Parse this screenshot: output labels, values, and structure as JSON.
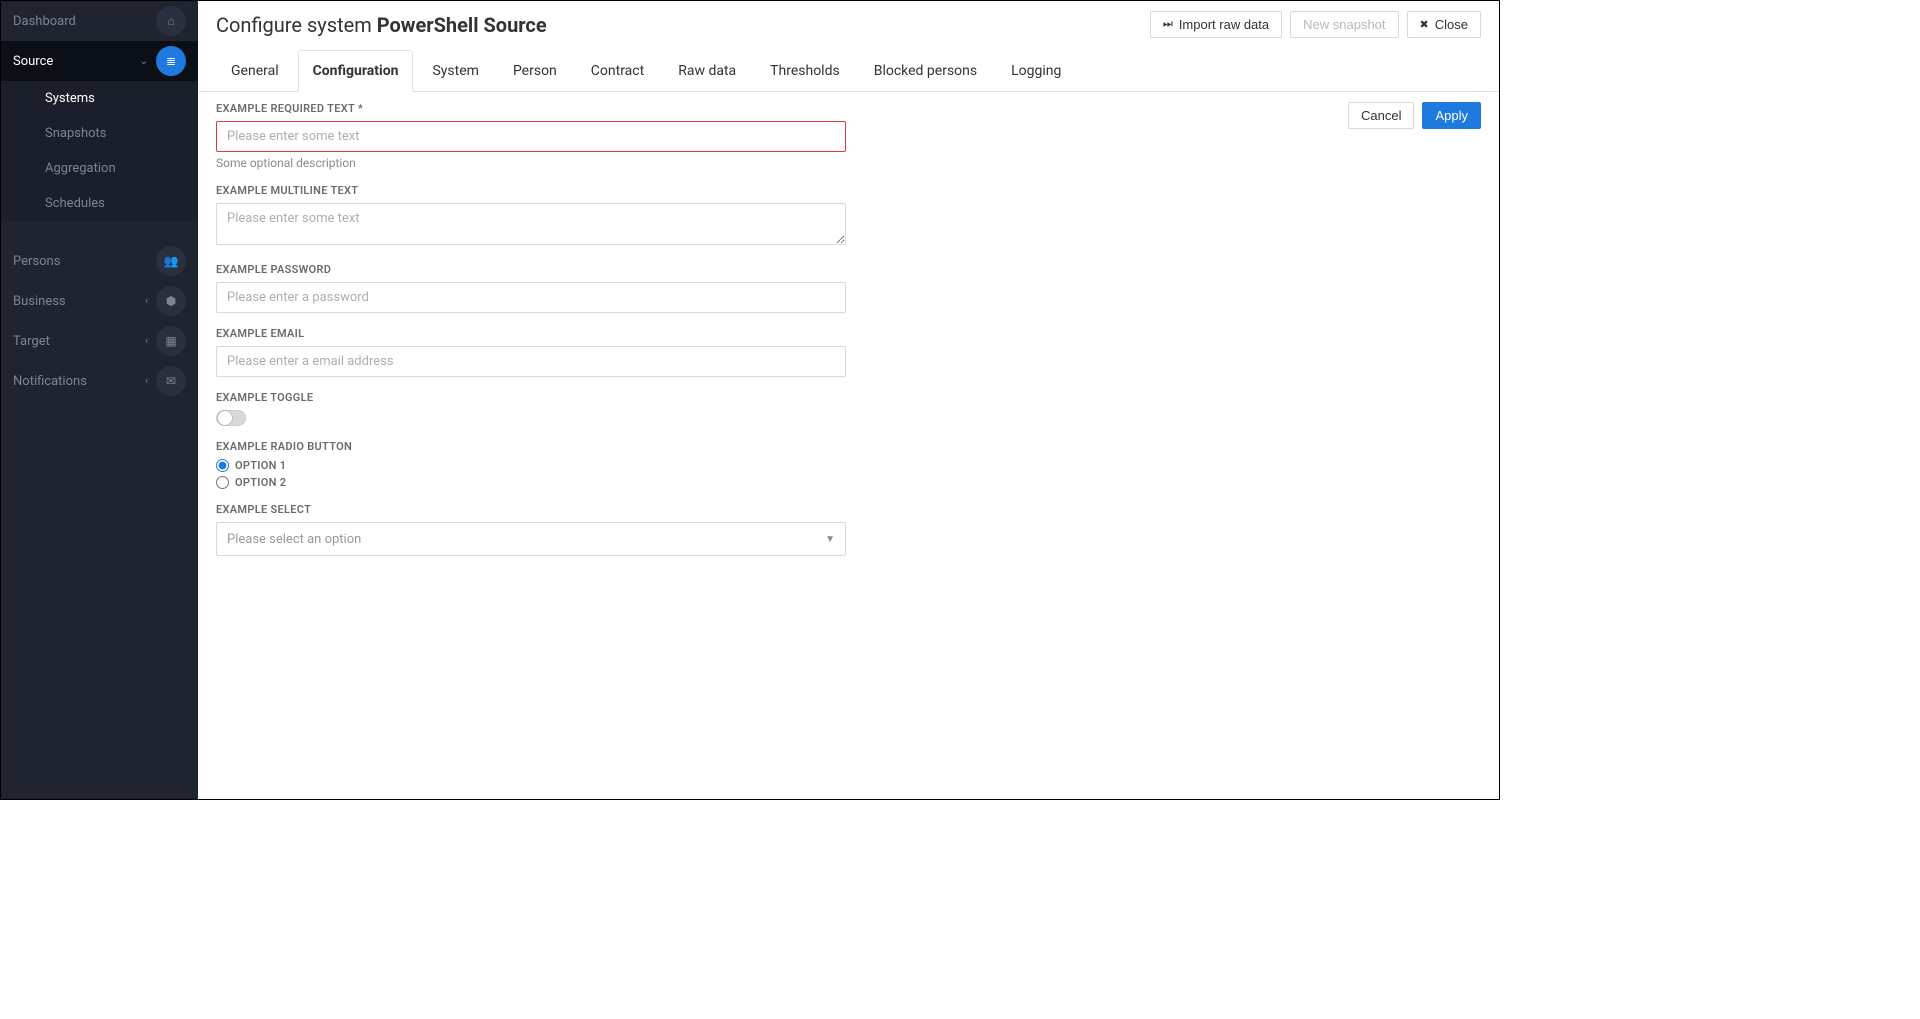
{
  "sidebar": {
    "items": [
      {
        "label": "Dashboard",
        "icon": "home-icon",
        "glyph": "⌂",
        "expandable": false,
        "active": false
      },
      {
        "label": "Source",
        "icon": "database-icon",
        "glyph": "≣",
        "expandable": true,
        "active": true,
        "icon_blue": true,
        "children": [
          {
            "label": "Systems",
            "selected": true
          },
          {
            "label": "Snapshots",
            "selected": false
          },
          {
            "label": "Aggregation",
            "selected": false
          },
          {
            "label": "Schedules",
            "selected": false
          }
        ]
      },
      {
        "label": "Persons",
        "icon": "users-icon",
        "glyph": "👥",
        "expandable": false,
        "active": false
      },
      {
        "label": "Business",
        "icon": "globe-icon",
        "glyph": "⬢",
        "expandable": true,
        "active": false
      },
      {
        "label": "Target",
        "icon": "grid-icon",
        "glyph": "▦",
        "expandable": true,
        "active": false
      },
      {
        "label": "Notifications",
        "icon": "envelope-icon",
        "glyph": "✉",
        "expandable": true,
        "active": false
      }
    ]
  },
  "header": {
    "title_prefix": "Configure system ",
    "title_bold": "PowerShell Source",
    "actions": {
      "import": "Import raw data",
      "snapshot": "New snapshot",
      "close": "Close"
    }
  },
  "tabs": [
    {
      "label": "General",
      "active": false
    },
    {
      "label": "Configuration",
      "active": true
    },
    {
      "label": "System",
      "active": false
    },
    {
      "label": "Person",
      "active": false
    },
    {
      "label": "Contract",
      "active": false
    },
    {
      "label": "Raw data",
      "active": false
    },
    {
      "label": "Thresholds",
      "active": false
    },
    {
      "label": "Blocked persons",
      "active": false
    },
    {
      "label": "Logging",
      "active": false
    }
  ],
  "form": {
    "required_text": {
      "label": "EXAMPLE REQUIRED TEXT *",
      "placeholder": "Please enter some text",
      "description": "Some optional description"
    },
    "multiline": {
      "label": "EXAMPLE MULTILINE TEXT",
      "placeholder": "Please enter some text"
    },
    "password": {
      "label": "EXAMPLE PASSWORD",
      "placeholder": "Please enter a password"
    },
    "email": {
      "label": "EXAMPLE EMAIL",
      "placeholder": "Please enter a email address"
    },
    "toggle": {
      "label": "EXAMPLE TOGGLE"
    },
    "radio": {
      "label": "EXAMPLE RADIO BUTTON",
      "options": [
        "OPTION 1",
        "OPTION 2"
      ],
      "selected": "OPTION 1"
    },
    "select": {
      "label": "EXAMPLE SELECT",
      "placeholder": "Please select an option"
    }
  },
  "content_actions": {
    "cancel": "Cancel",
    "apply": "Apply"
  }
}
